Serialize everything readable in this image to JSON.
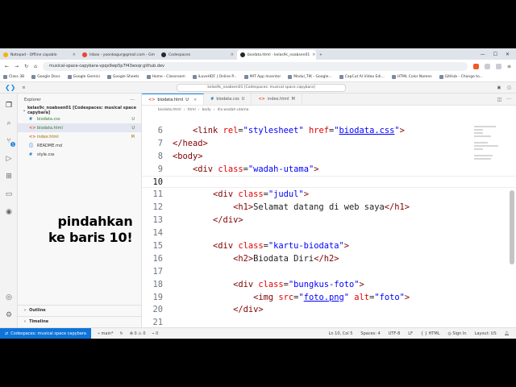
{
  "browser": {
    "tabs": [
      {
        "label": "Notepad - Offline capable",
        "color": "#f4b400"
      },
      {
        "label": "Inbox - yoonkagur@gmail.com - Gm",
        "color": "#ea4335"
      },
      {
        "label": "Codespaces",
        "color": "#24292f"
      },
      {
        "label": "biodata.html - kelas9c_noabsen01",
        "color": "#24292f"
      }
    ],
    "url": "musical-space-capybara-vpqx9wp5p7f43wxqr.github.dev",
    "bookmarks": [
      "Class 3B",
      "Google Docs",
      "Google Gemini",
      "Google Sheets",
      "Home - Classroom",
      "iLoveHDF | Online P...",
      "MIT App Inventor",
      "Modul_TIK - Google...",
      "CapCut AI Video Edi...",
      "HTML Color Names",
      "GitHub - Change to..."
    ]
  },
  "vscode": {
    "command_center": "kelas9c_noabsen01 [Codespaces: musical space capybara]",
    "explorer_title": "Explorer",
    "root_folder": "kelas9c_noabsen01 [Codespaces: musical space capybara]",
    "files": [
      {
        "name": "biodata.css",
        "status": "U"
      },
      {
        "name": "biodata.html",
        "status": "U"
      },
      {
        "name": "index.html",
        "status": "M"
      },
      {
        "name": "README.md",
        "status": ""
      },
      {
        "name": "style.css",
        "status": ""
      }
    ],
    "outline": "Outline",
    "timeline": "Timeline",
    "tabs": [
      {
        "name": "biodata.html",
        "status": "U"
      },
      {
        "name": "biodata.css",
        "status": "U"
      },
      {
        "name": "index.html",
        "status": "M"
      }
    ],
    "breadcrumbs": [
      "biodata.html",
      "html",
      "body",
      "div.wadah-utama"
    ],
    "overlay": [
      "pindahkan",
      "ke baris 10!"
    ],
    "status": {
      "remote": "Codespaces: musical space capybara",
      "branch": "main*",
      "problems": "0",
      "warnings": "0",
      "ports": "0",
      "position": "Ln 10, Col 5",
      "spaces": "Spaces: 4",
      "encoding": "UTF-8",
      "eol": "LF",
      "language": "HTML",
      "signin": "Sign In",
      "layout": "Layout: US"
    }
  },
  "code_lines": [
    {
      "n": "6",
      "html": "    <span class='tg'>&lt;link</span> <span class='at'>rel</span>=<span class='st2'>\"stylesheet\"</span> <span class='at'>href</span>=<span class='st2'>\"<span class='u'>biodata.css</span>\"</span><span class='tg'>&gt;</span>"
    },
    {
      "n": "7",
      "html": "<span class='tg'>&lt;/head&gt;</span>"
    },
    {
      "n": "8",
      "html": "<span class='tg'>&lt;body&gt;</span>"
    },
    {
      "n": "9",
      "html": "    <span class='tg'>&lt;div</span> <span class='at'>class</span>=<span class='st2'>\"wadah-utama\"</span><span class='tg'>&gt;</span>"
    },
    {
      "n": "10",
      "html": ""
    },
    {
      "n": "11",
      "html": "        <span class='tg'>&lt;div</span> <span class='at'>class</span>=<span class='st2'>\"judul\"</span><span class='tg'>&gt;</span>"
    },
    {
      "n": "12",
      "html": "            <span class='tg'>&lt;h1&gt;</span>Selamat datang di web saya<span class='tg'>&lt;/h1&gt;</span>"
    },
    {
      "n": "13",
      "html": "        <span class='tg'>&lt;/div&gt;</span>"
    },
    {
      "n": "14",
      "html": ""
    },
    {
      "n": "15",
      "html": "        <span class='tg'>&lt;div</span> <span class='at'>class</span>=<span class='st2'>\"kartu-biodata\"</span><span class='tg'>&gt;</span>"
    },
    {
      "n": "16",
      "html": "            <span class='tg'>&lt;h2&gt;</span>Biodata Diri<span class='tg'>&lt;/h2&gt;</span>"
    },
    {
      "n": "17",
      "html": ""
    },
    {
      "n": "18",
      "html": "            <span class='tg'>&lt;div</span> <span class='at'>class</span>=<span class='st2'>\"bungkus-foto\"</span><span class='tg'>&gt;</span>"
    },
    {
      "n": "19",
      "html": "                <span class='tg'>&lt;img</span> <span class='at'>src</span>=<span class='st2'>\"<span class='u'>foto.png</span>\"</span> <span class='at'>alt</span>=<span class='st2'>\"foto\"</span><span class='tg'>&gt;</span>"
    },
    {
      "n": "20",
      "html": "            <span class='tg'>&lt;/div&gt;</span>"
    },
    {
      "n": "21",
      "html": ""
    }
  ],
  "current_line": "10"
}
